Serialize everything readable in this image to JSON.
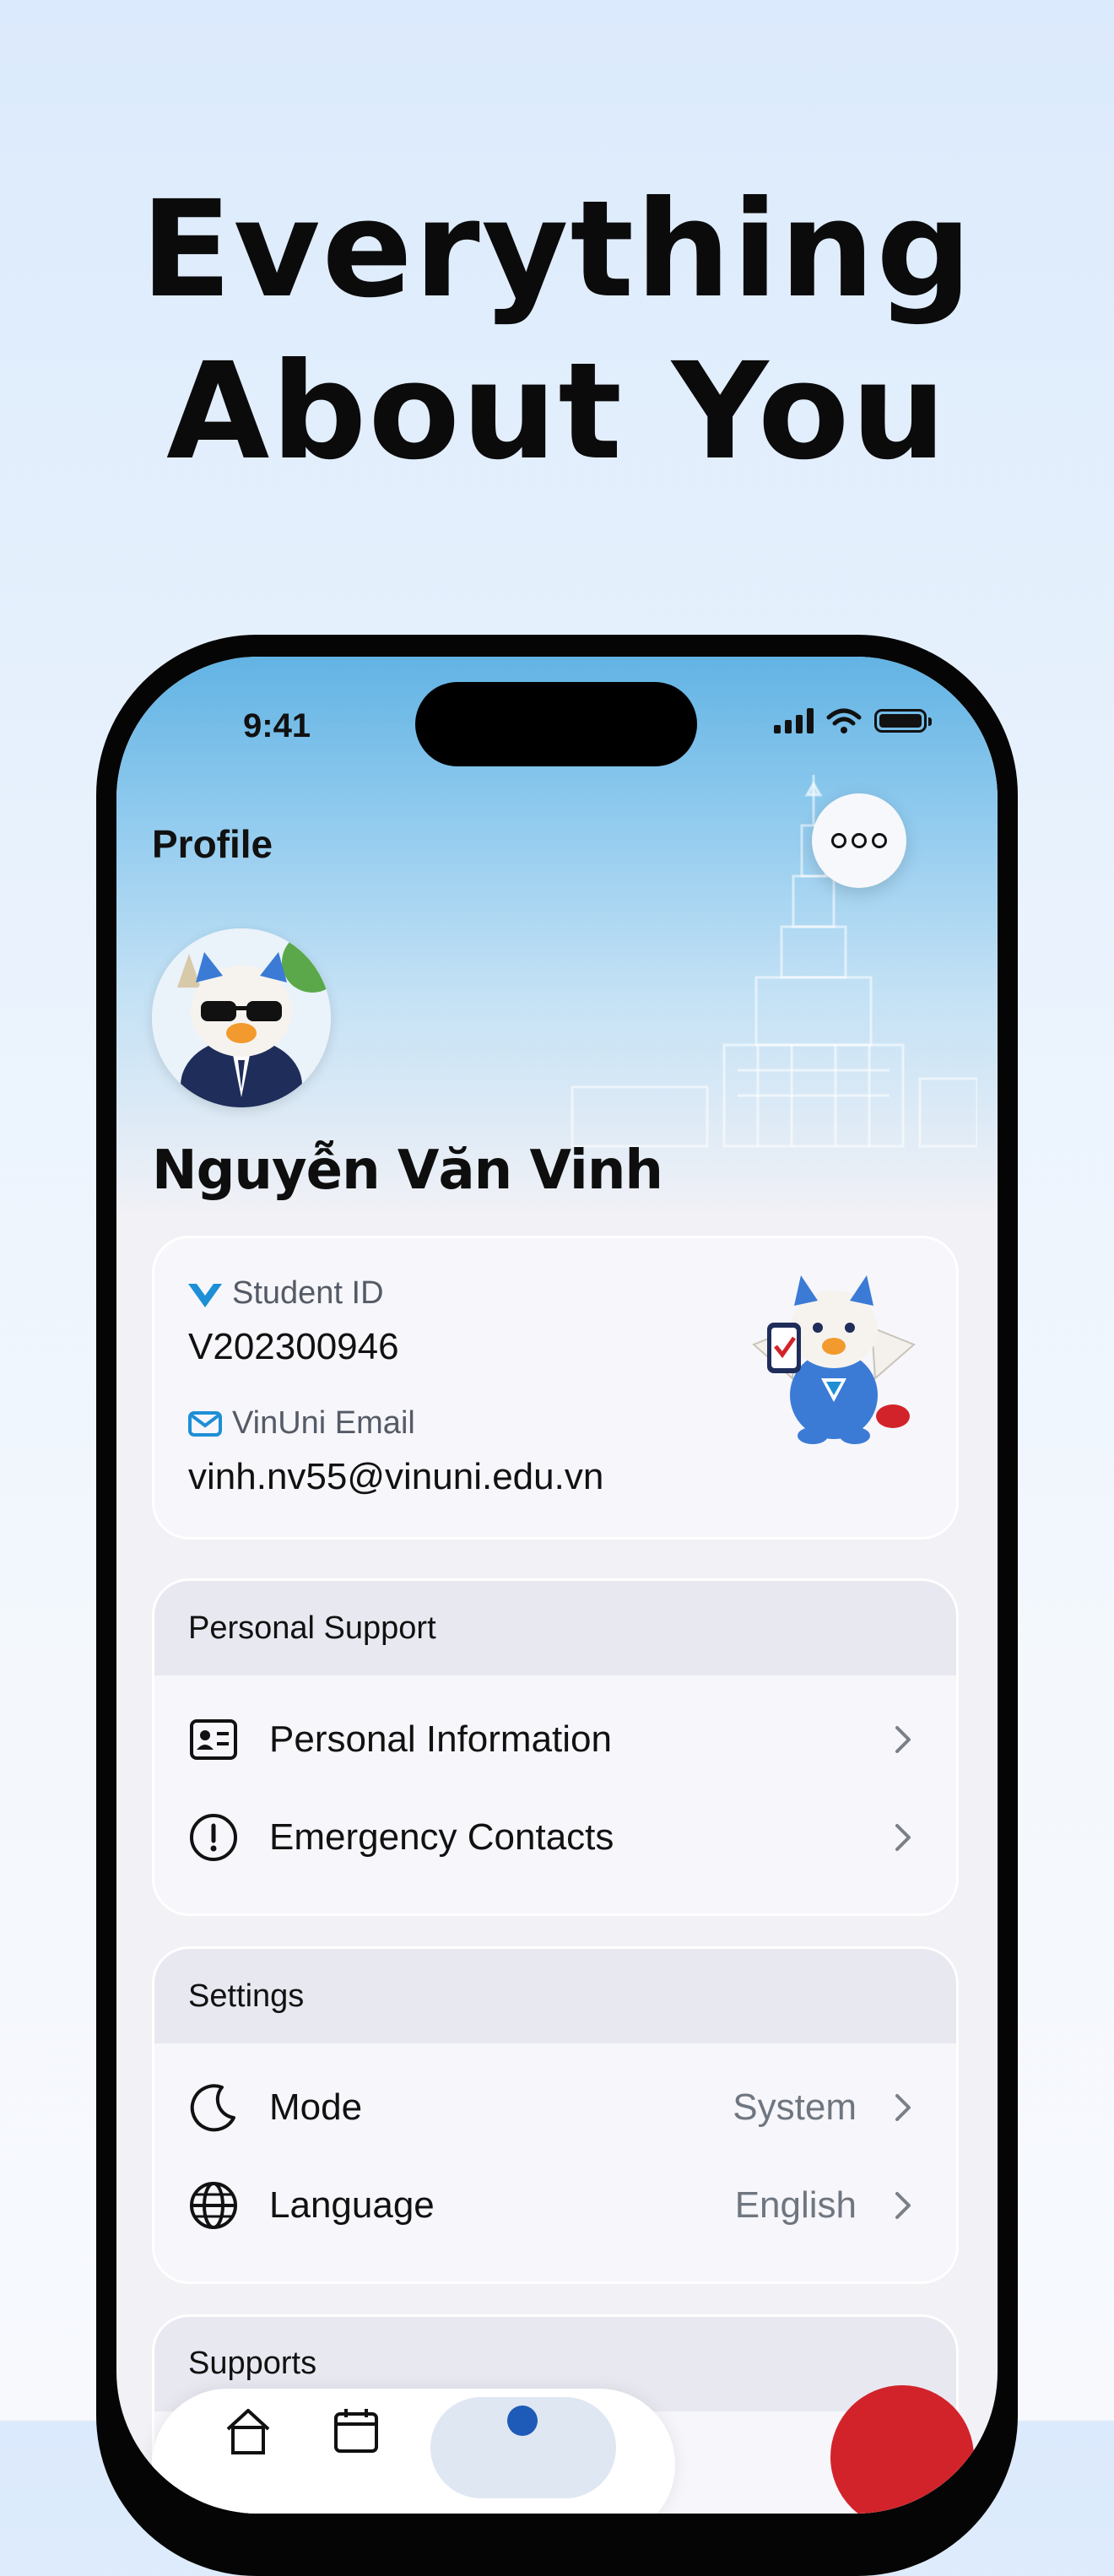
{
  "headline": {
    "line1": "Everything",
    "line2": "About You"
  },
  "status_bar": {
    "time": "9:41"
  },
  "header": {
    "title": "Profile"
  },
  "profile": {
    "name": "Nguyễn Văn Vinh",
    "student_id_label": "Student ID",
    "student_id": "V202300946",
    "email_label": "VinUni Email",
    "email": "vinh.nv55@vinuni.edu.vn"
  },
  "personal_support": {
    "title": "Personal Support",
    "items": [
      {
        "label": "Personal Information",
        "icon": "id-card-icon"
      },
      {
        "label": "Emergency Contacts",
        "icon": "alert-circle-icon"
      }
    ]
  },
  "settings": {
    "title": "Settings",
    "items": [
      {
        "label": "Mode",
        "value": "System",
        "icon": "moon-icon"
      },
      {
        "label": "Language",
        "value": "English",
        "icon": "globe-icon"
      }
    ]
  },
  "supports": {
    "title": "Supports"
  },
  "colors": {
    "accent_blue": "#1e5bb8",
    "check_blue": "#1d8fd6",
    "brand_red": "#d2232a",
    "hero_sky": "#62b3e4"
  }
}
